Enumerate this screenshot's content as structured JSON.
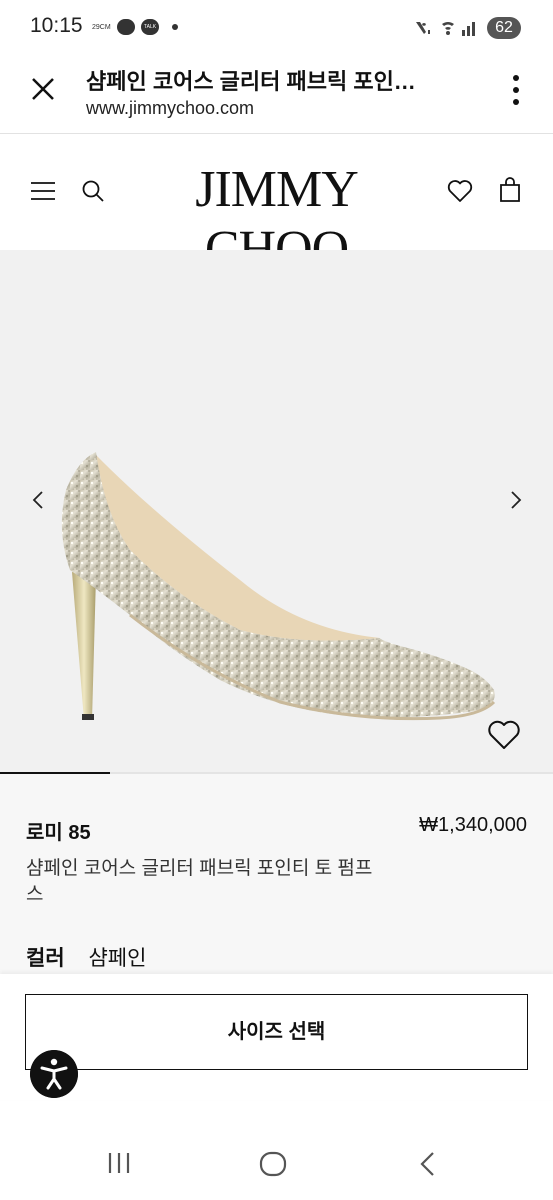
{
  "status_bar": {
    "time": "10:15",
    "temp": "29CM",
    "bubble_1": "",
    "bubble_2": "TALK",
    "battery": "62"
  },
  "browser": {
    "title": "샴페인 코어스 글리터 패브릭 포인…",
    "url": "www.jimmychoo.com"
  },
  "site_header": {
    "brand": "JIMMY CHOO"
  },
  "product": {
    "name": "로미 85",
    "price": "₩1,340,000",
    "description": "샴페인 코어스 글리터 패브릭 포인티 토 펌프스",
    "color_label": "컬러",
    "color_value": "샴페인"
  },
  "actions": {
    "size_select_label": "사이즈 선택"
  },
  "carousel": {
    "active_index": 1,
    "total": 5
  },
  "colors": {
    "accent": "#111111",
    "image_bg": "#f1f1f1",
    "info_bg": "#f7f7f7"
  },
  "icons": {
    "close": "close-icon",
    "more": "more-vertical-icon",
    "menu": "hamburger-menu-icon",
    "search": "search-icon",
    "wishlist": "heart-icon",
    "bag": "shopping-bag-icon",
    "prev": "chevron-left-icon",
    "next": "chevron-right-icon",
    "accessibility": "accessibility-icon"
  }
}
